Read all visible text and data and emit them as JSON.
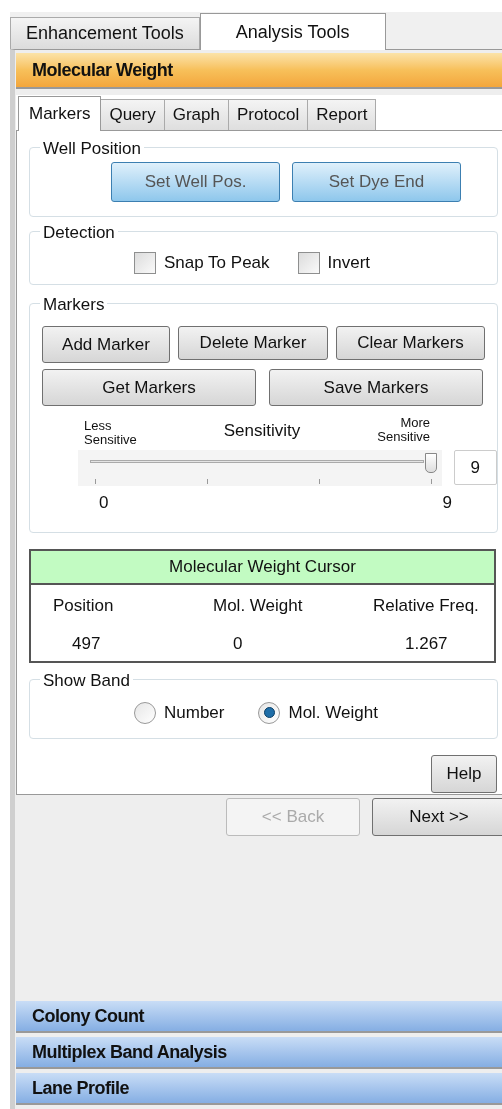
{
  "top_tabs": [
    {
      "label": "Enhancement Tools",
      "selected": false
    },
    {
      "label": "Analysis Tools",
      "selected": true
    }
  ],
  "active_section": {
    "title": "Molecular Weight"
  },
  "sub_tabs": [
    {
      "label": "Markers",
      "selected": true
    },
    {
      "label": "Query",
      "selected": false
    },
    {
      "label": "Graph",
      "selected": false
    },
    {
      "label": "Protocol",
      "selected": false
    },
    {
      "label": "Report",
      "selected": false
    }
  ],
  "well_position": {
    "title": "Well Position",
    "buttons": [
      "Set Well Pos.",
      "Set Dye End"
    ]
  },
  "detection": {
    "title": "Detection",
    "checkboxes": [
      {
        "label": "Snap To Peak",
        "checked": false
      },
      {
        "label": "Invert",
        "checked": false
      }
    ]
  },
  "markers": {
    "title": "Markers",
    "buttons_row1": [
      "Add Marker",
      "Delete Marker",
      "Clear Markers"
    ],
    "buttons_row2": [
      "Get Markers",
      "Save Markers"
    ],
    "slider": {
      "less_label": "Less Sensitive",
      "title": "Sensitivity",
      "more_label": "More Sensitive",
      "level": 1,
      "value": "9",
      "min_label": "0",
      "max_label": "9"
    }
  },
  "cursor": {
    "title": "Molecular Weight Cursor",
    "columns": [
      "Position",
      "Mol. Weight",
      "Relative Freq."
    ],
    "values": [
      "497",
      "0",
      "1.267"
    ]
  },
  "show_band": {
    "title": "Show Band",
    "options": [
      {
        "label": "Number",
        "selected": false
      },
      {
        "label": "Mol. Weight",
        "selected": true
      }
    ]
  },
  "help_button": "Help",
  "nav_buttons": [
    {
      "label": "<< Back",
      "disabled": true
    },
    {
      "label": "Next >>",
      "disabled": false
    }
  ],
  "sections": [
    "Colony Count",
    "Multiplex Band Analysis",
    "Lane Profile"
  ]
}
